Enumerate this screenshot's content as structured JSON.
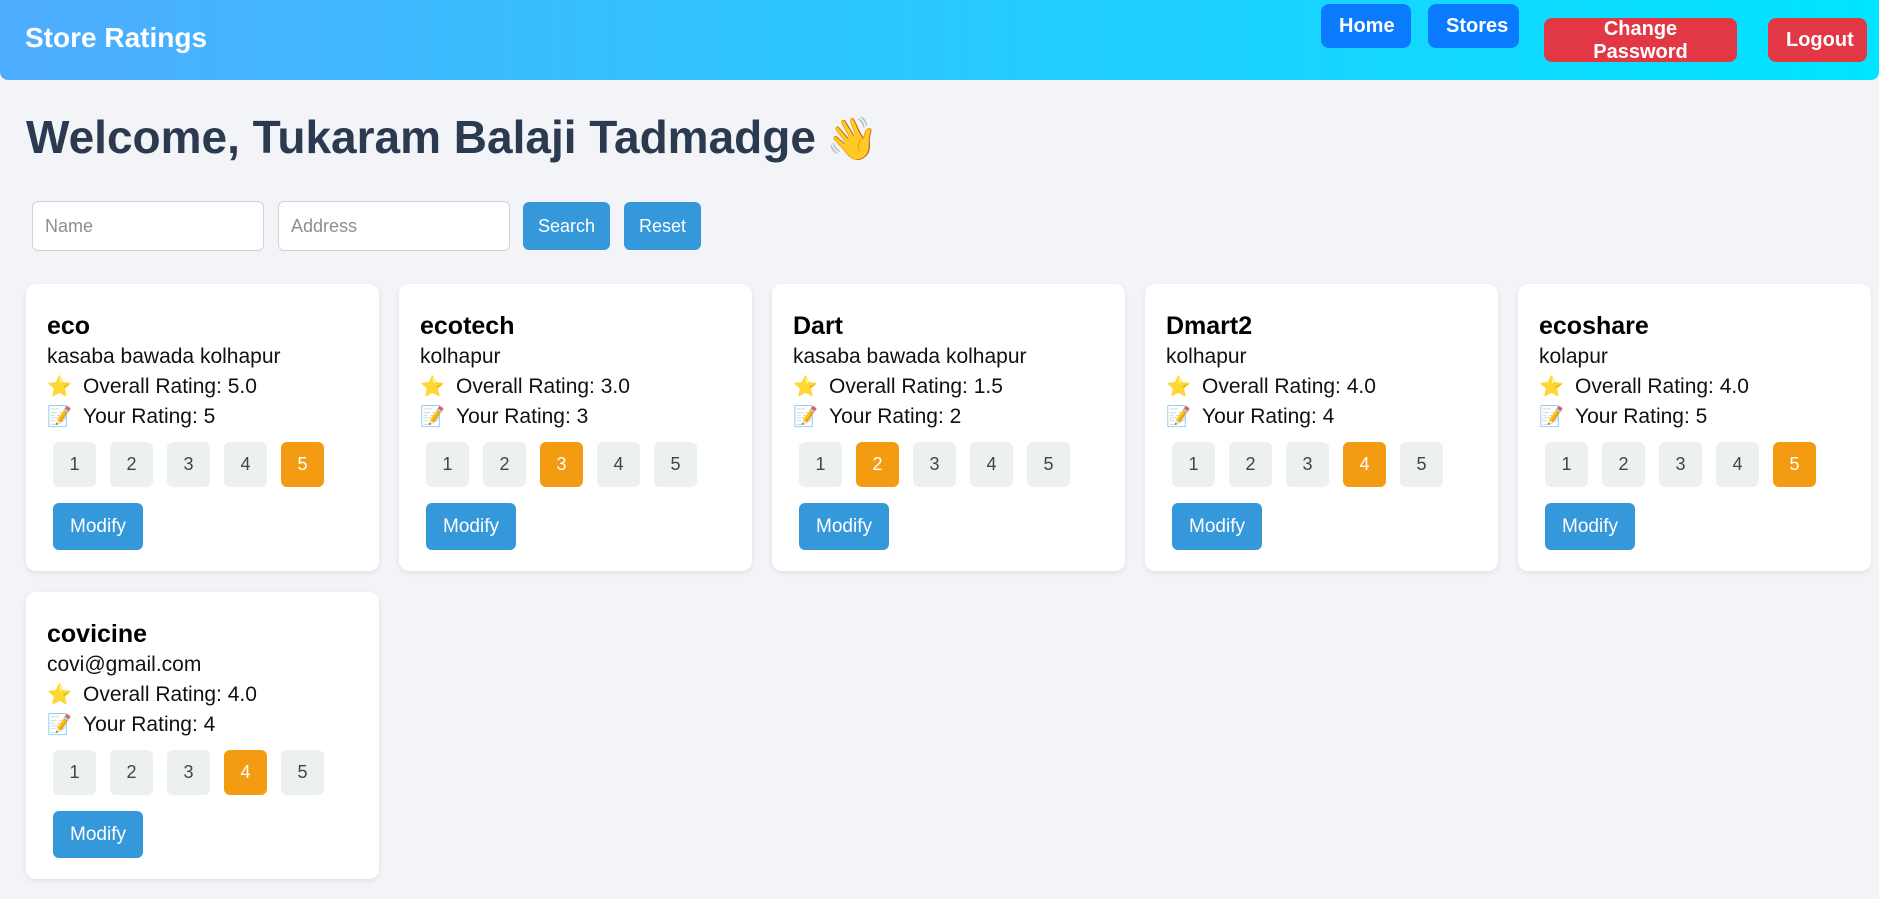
{
  "navbar": {
    "brand": "Store Ratings",
    "home_label": "Home",
    "stores_label": "Stores",
    "change_password_label": "Change Password",
    "logout_label": "Logout"
  },
  "welcome": {
    "text": "Welcome, Tukaram Balaji Tadmadge",
    "emoji": "👋"
  },
  "search": {
    "name_placeholder": "Name",
    "address_placeholder": "Address",
    "search_label": "Search",
    "reset_label": "Reset"
  },
  "labels": {
    "overall_prefix": "Overall Rating: ",
    "your_prefix": "Your Rating: ",
    "modify": "Modify",
    "star_emoji": "⭐",
    "memo_emoji": "📝"
  },
  "colors": {
    "accent": "#3498db",
    "selected": "#f39c12",
    "danger": "#e23744",
    "nav_primary": "#0a7bff"
  },
  "rating_options": [
    "1",
    "2",
    "3",
    "4",
    "5"
  ],
  "stores": [
    {
      "name": "eco",
      "address": "kasaba bawada kolhapur",
      "overall": "5.0",
      "yours": "5"
    },
    {
      "name": "ecotech",
      "address": "kolhapur",
      "overall": "3.0",
      "yours": "3"
    },
    {
      "name": "Dart",
      "address": "kasaba bawada kolhapur",
      "overall": "1.5",
      "yours": "2"
    },
    {
      "name": "Dmart2",
      "address": "kolhapur",
      "overall": "4.0",
      "yours": "4"
    },
    {
      "name": "ecoshare",
      "address": "kolapur",
      "overall": "4.0",
      "yours": "5"
    },
    {
      "name": "covicine",
      "address": "covi@gmail.com",
      "overall": "4.0",
      "yours": "4"
    }
  ]
}
